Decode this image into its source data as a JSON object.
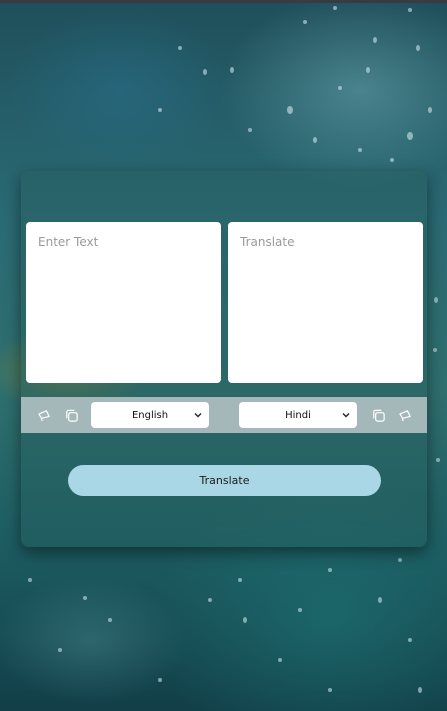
{
  "input": {
    "placeholder": "Enter Text",
    "value": ""
  },
  "output": {
    "placeholder": "Translate",
    "value": ""
  },
  "languages": {
    "source": "English",
    "target": "Hindi"
  },
  "actions": {
    "translate_label": "Translate"
  },
  "icons": {
    "source_speak": "megaphone-icon",
    "source_copy": "copy-icon",
    "target_copy": "copy-icon",
    "target_speak": "megaphone-icon"
  },
  "colors": {
    "button": "#a9d7e6",
    "control_bar": "#afbec0",
    "card": "#285f5f"
  }
}
